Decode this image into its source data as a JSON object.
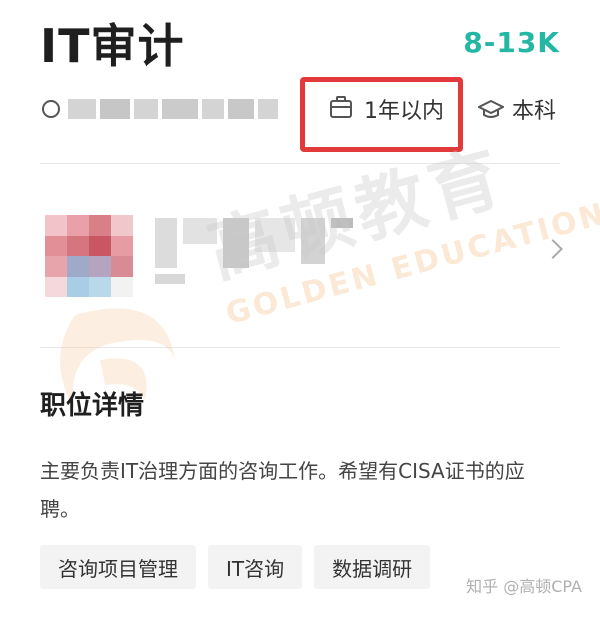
{
  "job": {
    "title": "IT审计",
    "salary": "8-13K",
    "experience": "1年以内",
    "education": "本科"
  },
  "details": {
    "section_title": "职位详情",
    "description": "主要负责IT治理方面的咨询工作。希望有CISA证书的应聘。",
    "tags": [
      "咨询项目管理",
      "IT咨询",
      "数据调研"
    ]
  },
  "watermark": {
    "cn": "高顿教育",
    "en": "GOLDEN EDUCATION",
    "footer": "知乎 @高顿CPA"
  },
  "icons": {
    "location": "location-pin-icon",
    "experience": "briefcase-icon",
    "education": "graduation-cap-icon",
    "company_arrow": "chevron-right-icon"
  },
  "colors": {
    "salary": "#24b8a4",
    "highlight_box": "#e23a3a",
    "watermark_orange": "#f5c08a"
  }
}
